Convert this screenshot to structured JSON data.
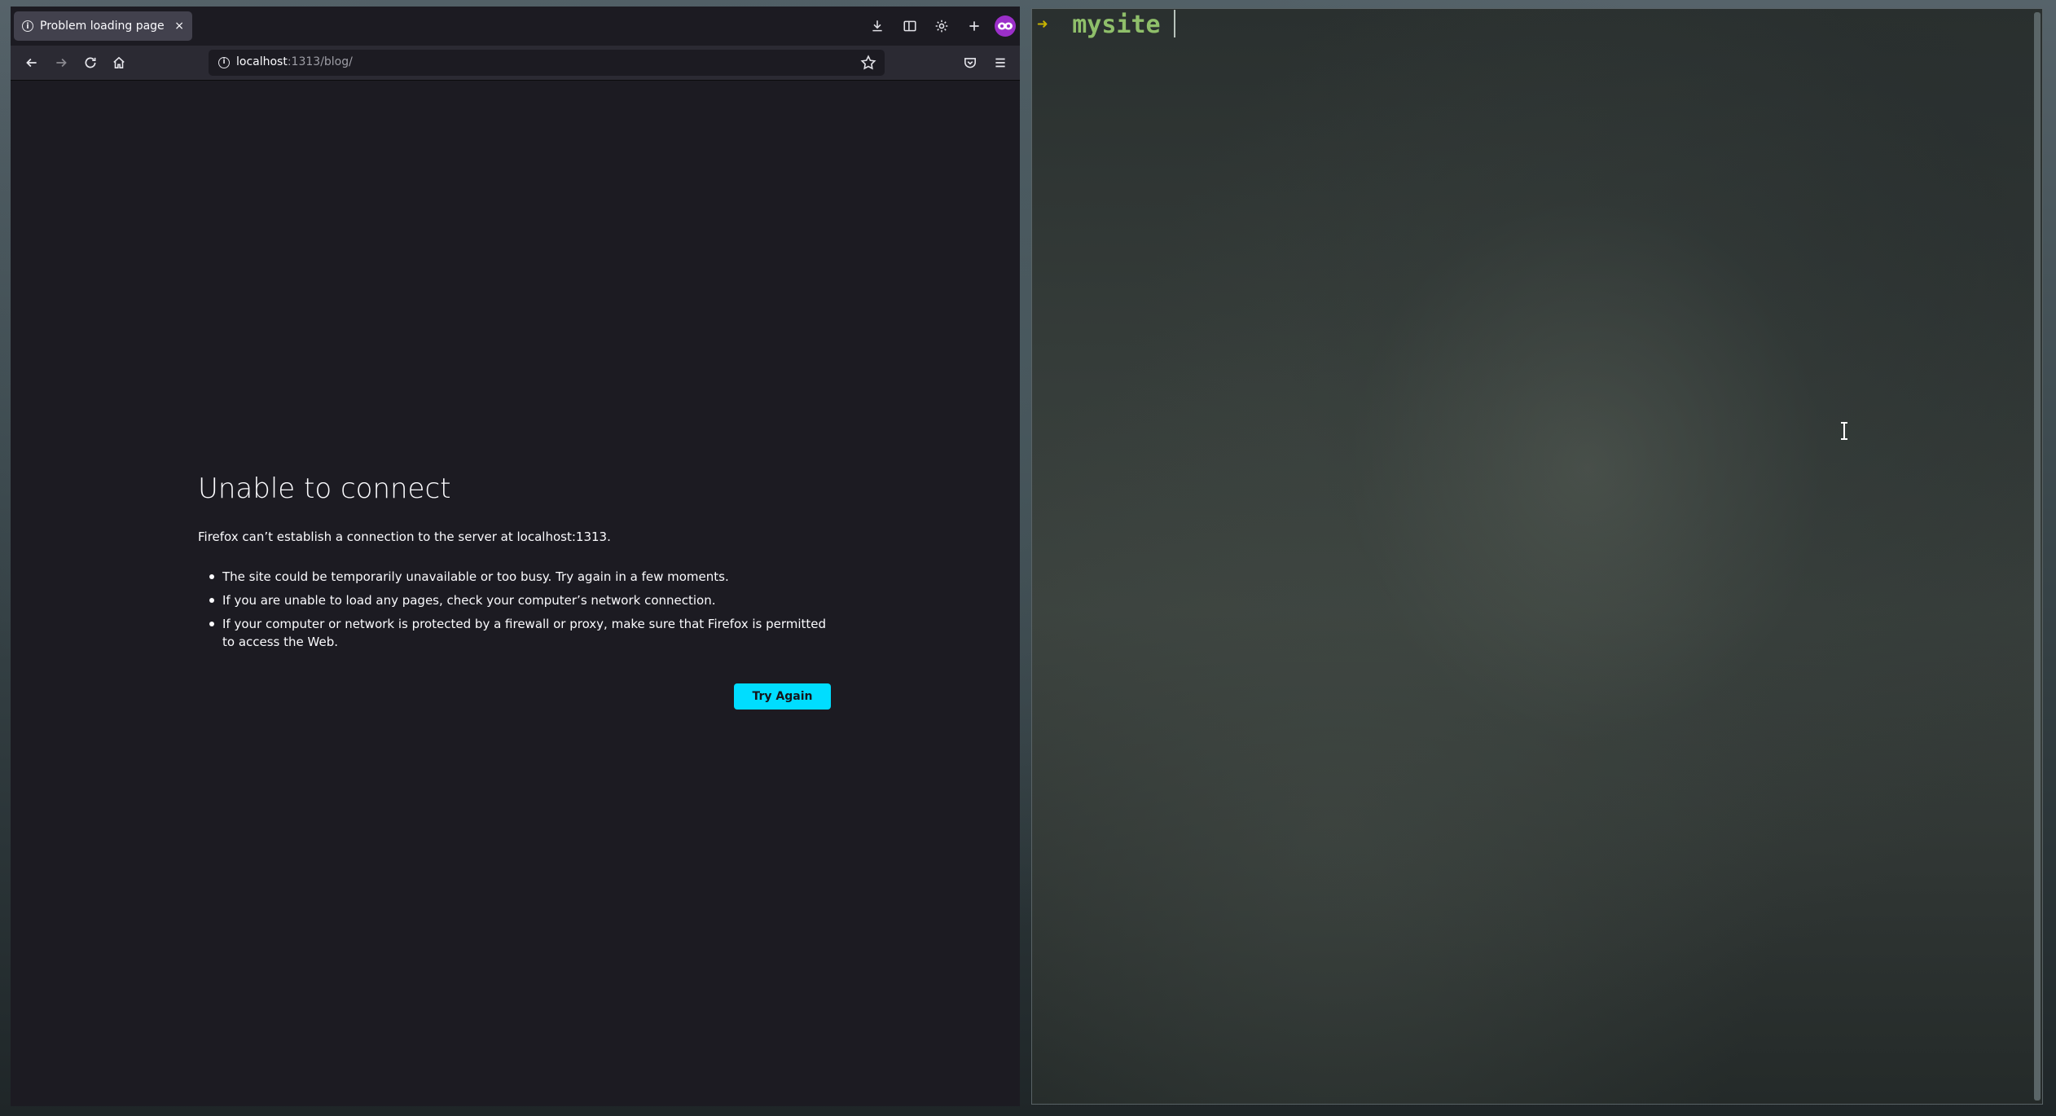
{
  "browser": {
    "tab": {
      "title": "Problem loading page",
      "close_glyph": "×"
    },
    "toolbar_icons": [
      "download-icon",
      "sidebar-icon",
      "gear-icon",
      "new-tab-icon",
      "private-browsing-icon"
    ],
    "nav": {
      "url_host": "localhost",
      "url_rest": ":1313/blog/",
      "icons": [
        "back-icon",
        "forward-icon",
        "reload-icon",
        "home-icon",
        "star-icon",
        "pocket-icon",
        "menu-icon"
      ]
    },
    "error": {
      "title": "Unable to connect",
      "description": "Firefox can’t establish a connection to the server at localhost:1313.",
      "items": [
        "The site could be temporarily unavailable or too busy. Try again in a few moments.",
        "If you are unable to load any pages, check your computer’s network connection.",
        "If your computer or network is protected by a firewall or proxy, make sure that Firefox is permitted to access the Web."
      ],
      "button_label": "Try Again",
      "button_color": "#00ddff"
    }
  },
  "terminal": {
    "prompt_symbol": "➜",
    "directory": "mysite",
    "prompt_color": "#c8b400",
    "directory_color": "#8fbf6a"
  }
}
